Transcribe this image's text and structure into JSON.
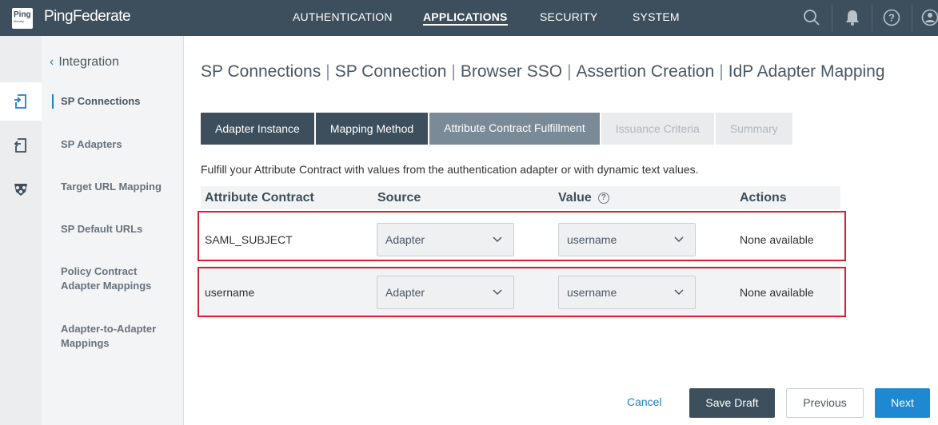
{
  "header": {
    "logo_text": "Ping",
    "logo_subtext": "Identity",
    "brand": "PingFederate",
    "nav": [
      {
        "label": "AUTHENTICATION"
      },
      {
        "label": "APPLICATIONS"
      },
      {
        "label": "SECURITY"
      },
      {
        "label": "SYSTEM"
      }
    ]
  },
  "sidebar": {
    "back_label": "Integration",
    "items": [
      {
        "label": "SP Connections"
      },
      {
        "label": "SP Adapters"
      },
      {
        "label": "Target URL Mapping"
      },
      {
        "label": "SP Default URLs"
      },
      {
        "label": "Policy Contract Adapter Mappings"
      },
      {
        "label": "Adapter-to-Adapter Mappings"
      }
    ]
  },
  "breadcrumb": [
    "SP Connections",
    "SP Connection",
    "Browser SSO",
    "Assertion Creation",
    "IdP Adapter Mapping"
  ],
  "tabs": [
    {
      "label": "Adapter Instance"
    },
    {
      "label": "Mapping Method"
    },
    {
      "label": "Attribute Contract Fulfillment"
    },
    {
      "label": "Issuance Criteria"
    },
    {
      "label": "Summary"
    }
  ],
  "description": "Fulfill your Attribute Contract with values from the authentication adapter or with dynamic text values.",
  "table": {
    "headers": {
      "contract": "Attribute Contract",
      "source": "Source",
      "value": "Value",
      "actions": "Actions"
    },
    "help_glyph": "?",
    "rows": [
      {
        "contract": "SAML_SUBJECT",
        "source": "Adapter",
        "value": "username",
        "actions": "None available"
      },
      {
        "contract": "username",
        "source": "Adapter",
        "value": "username",
        "actions": "None available"
      }
    ]
  },
  "footer": {
    "cancel": "Cancel",
    "save_draft": "Save Draft",
    "previous": "Previous",
    "next": "Next"
  },
  "colors": {
    "nav_bg": "#3d4f5c",
    "accent": "#1e88d0",
    "highlight": "#d7212f"
  }
}
